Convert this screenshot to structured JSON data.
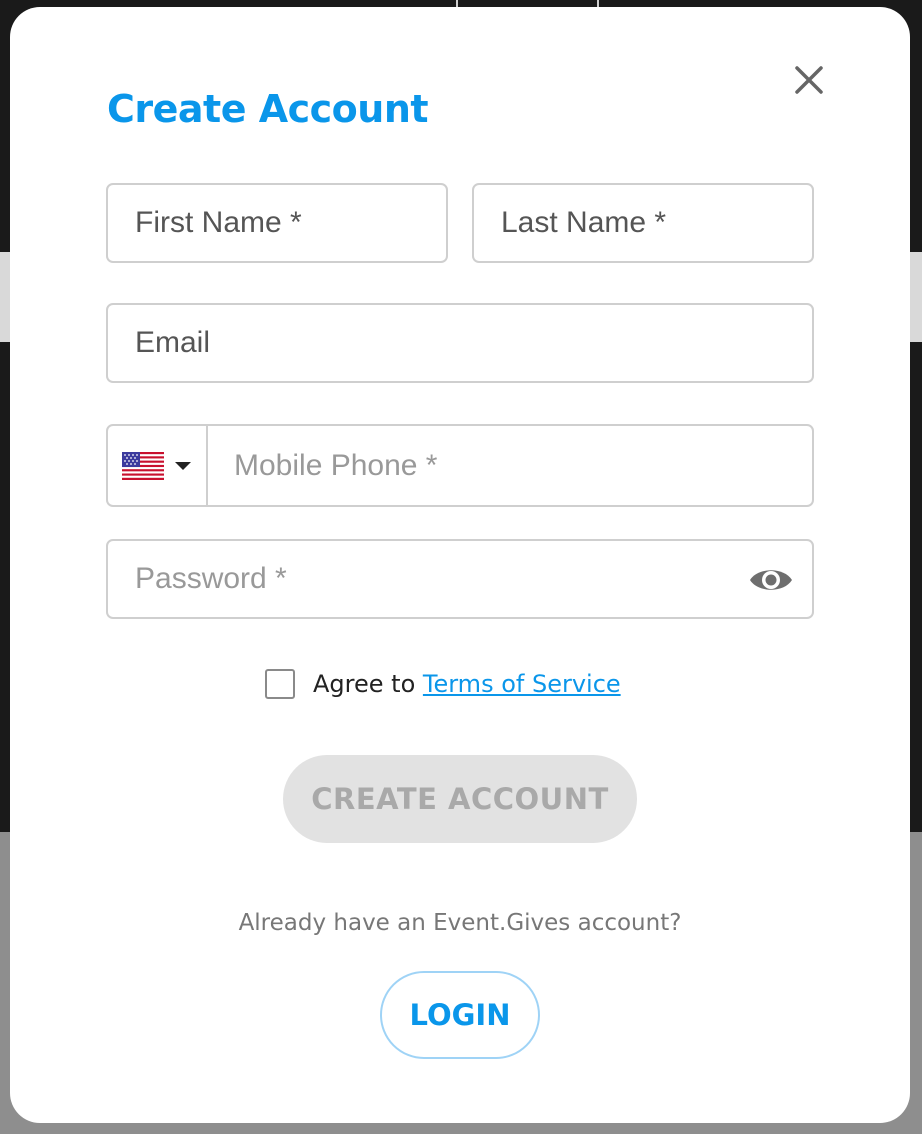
{
  "modal": {
    "title": "Create Account",
    "close_icon": "close-icon"
  },
  "form": {
    "first_name_placeholder": "First Name *",
    "last_name_placeholder": "Last Name *",
    "email_placeholder": "Email",
    "phone": {
      "country_flag_icon": "us-flag-icon",
      "dropdown_icon": "caret-down-icon",
      "placeholder": "Mobile Phone *"
    },
    "password_placeholder": "Password *",
    "password_toggle_icon": "eye-icon",
    "terms": {
      "prefix": "Agree to",
      "link": "Terms of Service"
    },
    "create_button_label": "CREATE ACCOUNT"
  },
  "footer": {
    "already_text": "Already have an Event.Gives account?",
    "login_button_label": "LOGIN"
  },
  "colors": {
    "accent": "#0a96ea",
    "disabled_button_bg": "#e2e2e2",
    "disabled_button_text": "#a9a9a9",
    "border": "#cfcfcf"
  }
}
